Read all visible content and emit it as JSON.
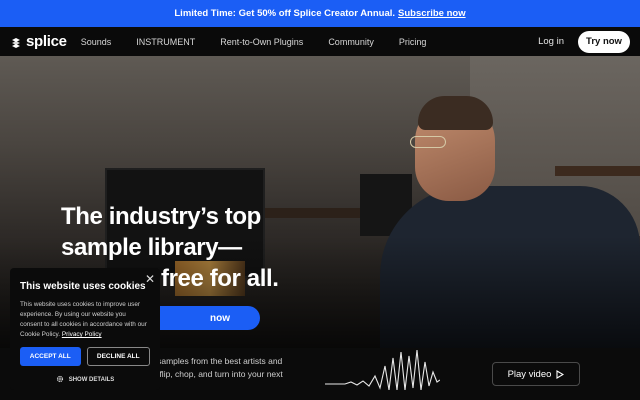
{
  "promo": {
    "text": "Limited Time: Get 50% off Splice Creator Annual.",
    "link": "Subscribe now"
  },
  "nav": {
    "logo": "splice",
    "links": [
      "Sounds",
      "INSTRUMENT",
      "Rent-to-Own Plugins",
      "Community",
      "Pricing"
    ],
    "login": "Log in",
    "try_now": "Try now"
  },
  "hero": {
    "headline_line1": "The industry’s top",
    "headline_line2": "sample library—",
    "headline_line3_visible": "free for all.",
    "cta_visible": "now"
  },
  "strip": {
    "line1_visible": "n samples from the best artists and",
    "line2_visible": "to flip, chop, and turn into your next",
    "play_label": "Play video"
  },
  "cookie": {
    "title": "This website uses cookies",
    "body": "This website uses cookies to improve user experience. By using our website you consent to all cookies in accordance with our Cookie Policy.",
    "policy_link": "Privacy Policy",
    "accept": "ACCEPT ALL",
    "decline": "DECLINE ALL",
    "details": "SHOW DETAILS"
  },
  "colors": {
    "accent": "#1b5ef5",
    "nav_bg": "#0a0a0a"
  }
}
